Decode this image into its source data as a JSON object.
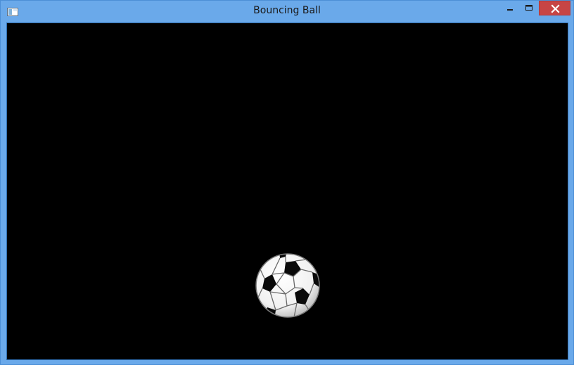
{
  "window": {
    "title": "Bouncing Ball"
  },
  "controls": {
    "minimize_icon": "minimize-icon",
    "maximize_icon": "maximize-icon",
    "close_icon": "close-icon"
  },
  "canvas": {
    "background": "#000000",
    "ball_icon": "soccer-ball-icon"
  },
  "colors": {
    "frame": "#6aa9ea",
    "close_button": "#c74545"
  }
}
